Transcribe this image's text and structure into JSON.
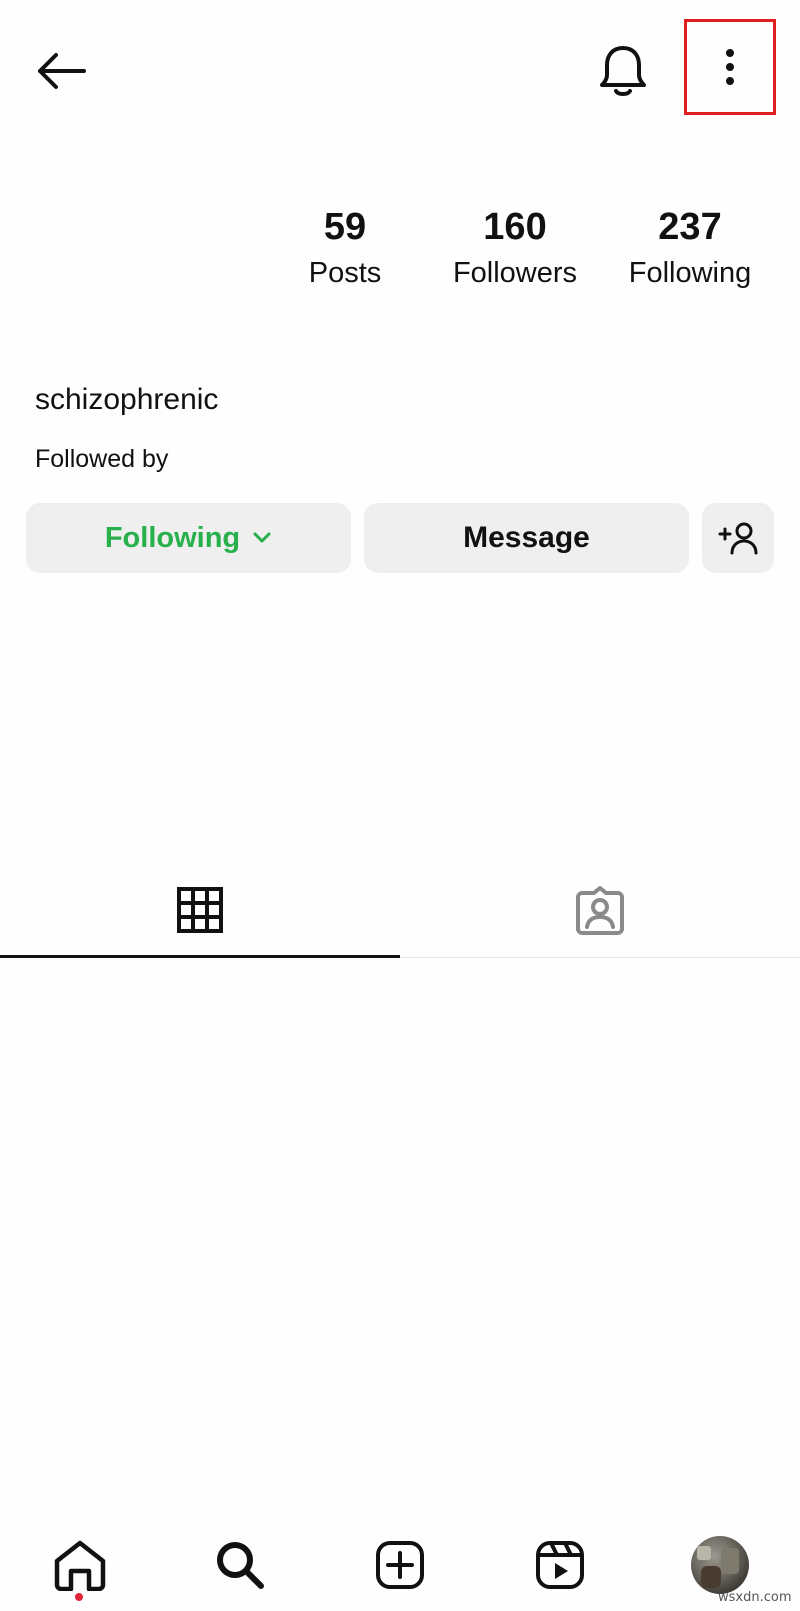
{
  "header": {
    "back_icon": "arrow-left-icon",
    "notifications_icon": "bell-icon",
    "more_icon": "more-vertical-icon",
    "highlight_color": "#e02020"
  },
  "profile": {
    "stats": [
      {
        "value": "59",
        "label": "Posts"
      },
      {
        "value": "160",
        "label": "Followers"
      },
      {
        "value": "237",
        "label": "Following"
      }
    ],
    "username": "schizophrenic",
    "followed_by": "Followed by"
  },
  "actions": {
    "following_label": "Following",
    "following_color": "#27b04c",
    "message_label": "Message",
    "add_user_icon": "add-user-icon"
  },
  "tabs": [
    {
      "icon": "grid-icon",
      "selected": true
    },
    {
      "icon": "tagged-person-icon",
      "selected": false
    }
  ],
  "bottom_nav": {
    "items": [
      "home-icon",
      "search-icon",
      "create-icon",
      "reels-icon",
      "profile-avatar"
    ],
    "notification_dot_color": "#e0243a"
  },
  "watermark": "wsxdn.com"
}
